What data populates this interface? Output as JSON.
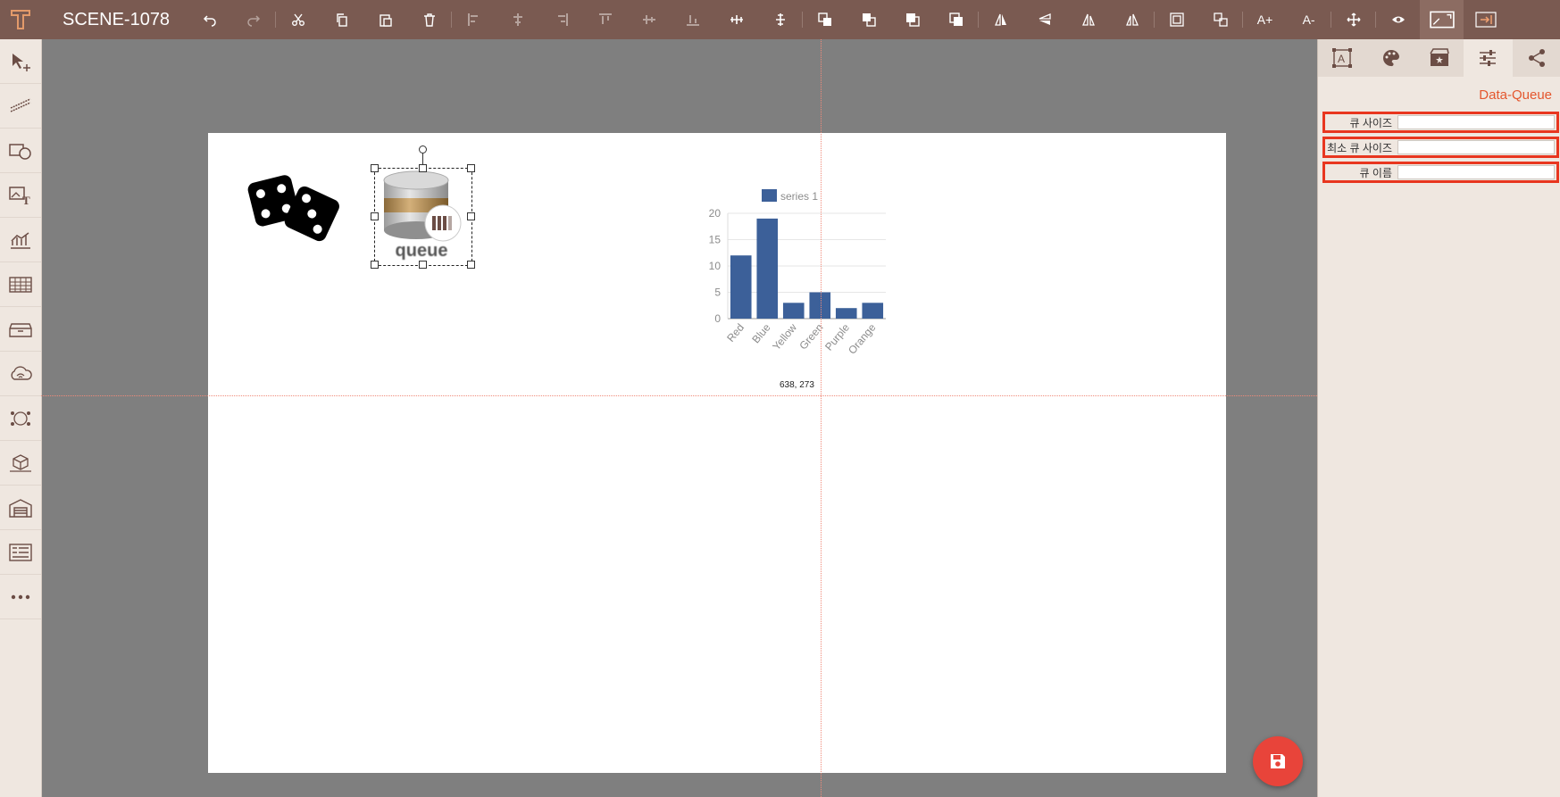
{
  "app": {
    "scene_title": "SCENE-1078"
  },
  "toolbar": {
    "groups": [
      [
        "undo-icon",
        "redo-icon"
      ],
      [
        "cut-icon",
        "copy-icon",
        "paste-icon",
        "delete-icon"
      ],
      [
        "align-left-icon",
        "align-center-icon",
        "align-right-icon",
        "align-top-icon",
        "align-middle-icon",
        "align-bottom-icon",
        "distribute-horizontal-icon",
        "distribute-vertical-icon"
      ],
      [
        "bring-forward-icon",
        "send-backward-icon",
        "bring-to-front-icon",
        "send-to-back-icon"
      ],
      [
        "flip-horizontal-icon",
        "flip-vertical-icon",
        "rotate-cw-icon",
        "rotate-ccw-icon"
      ],
      [
        "group-icon",
        "ungroup-icon"
      ],
      [
        "font-increase-icon",
        "font-decrease-icon"
      ],
      [
        "move-icon"
      ],
      [
        "preview-icon",
        "fullscreen-icon",
        "export-icon"
      ]
    ],
    "font_increase_label": "A+",
    "font_decrease_label": "A-"
  },
  "left_tools": [
    "pointer-tool-icon",
    "line-tool-icon",
    "shape-tool-icon",
    "image-text-tool-icon",
    "chart-tool-icon",
    "table-tool-icon",
    "storage-tool-icon",
    "cloud-tool-icon",
    "network-tool-icon",
    "3d-tool-icon",
    "warehouse-tool-icon",
    "form-tool-icon",
    "more-tool-icon"
  ],
  "canvas": {
    "cursor_readout": "638, 273",
    "queue_label": "queue"
  },
  "chart_data": {
    "type": "bar",
    "categories": [
      "Red",
      "Blue",
      "Yellow",
      "Green",
      "Purple",
      "Orange"
    ],
    "series": [
      {
        "name": "series 1",
        "values": [
          12,
          19,
          3,
          5,
          2,
          3
        ]
      }
    ],
    "yticks": [
      0,
      5,
      10,
      15,
      20
    ],
    "ylim": [
      0,
      20
    ],
    "grid": true,
    "legend": "top",
    "bar_color": "#3c6099"
  },
  "right_panel": {
    "tabs": [
      "text-style-icon",
      "palette-icon",
      "animation-icon",
      "properties-icon",
      "share-icon"
    ],
    "active_tab": 3,
    "component_title": "Data-Queue",
    "properties": [
      {
        "label": "큐 사이즈",
        "value": ""
      },
      {
        "label": "최소 큐 사이즈",
        "value": ""
      },
      {
        "label": "큐 이름",
        "value": ""
      }
    ]
  },
  "colors": {
    "toolbar_bg": "#7a5a51",
    "accent": "#e4572e",
    "highlight_border": "#e8361f",
    "save_button": "#e8443a"
  }
}
